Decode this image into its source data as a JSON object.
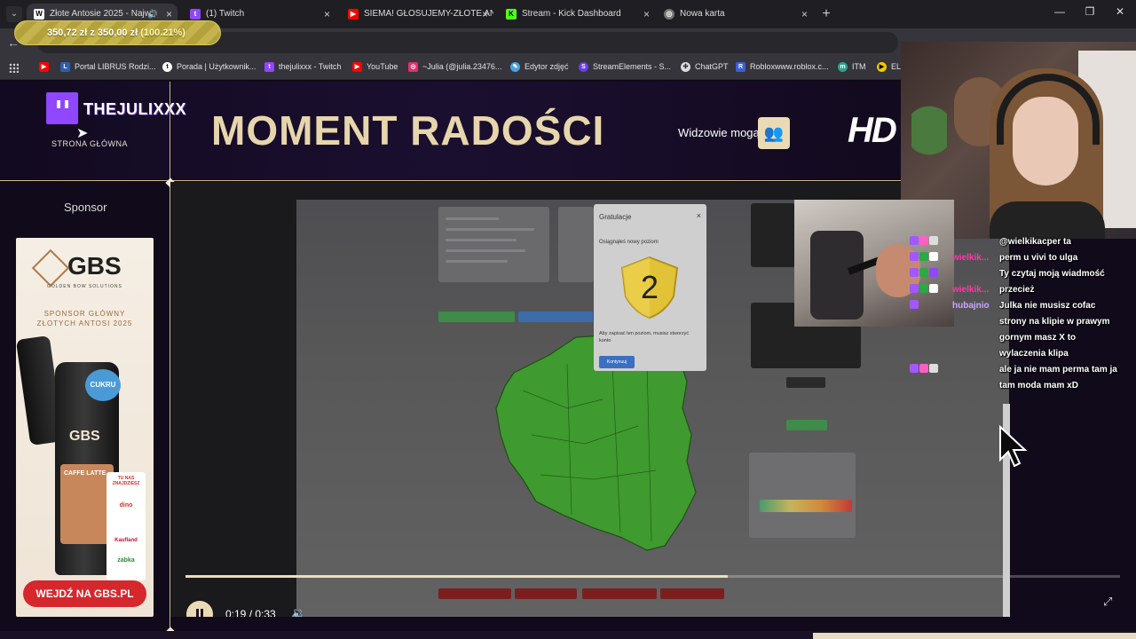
{
  "browser": {
    "tabs": [
      {
        "title": "Złote Antosie 2025 - Najwi",
        "active": true,
        "favicon": "wiki-icon"
      },
      {
        "title": "(1) Twitch",
        "active": false,
        "favicon": "twitch-icon"
      },
      {
        "title": "SIEMA! GŁOSUJEMY-ZŁOTE AN",
        "active": false,
        "favicon": "youtube-icon"
      },
      {
        "title": "Stream - Kick Dashboard",
        "active": false,
        "favicon": "kick-icon"
      },
      {
        "title": "Nowa karta",
        "active": false,
        "favicon": "chrome-icon"
      }
    ],
    "bookmarks": [
      {
        "label": "",
        "icon": "youtube-icon"
      },
      {
        "label": "Portal LIBRUS Rodzi...",
        "icon": "librus-icon"
      },
      {
        "label": "Porada | Użytkownik...",
        "icon": "tip-icon"
      },
      {
        "label": "thejulixxx - Twitch",
        "icon": "twitch-icon"
      },
      {
        "label": "YouTube",
        "icon": "youtube-icon"
      },
      {
        "label": "~Julia (@julia.23476...",
        "icon": "instagram-icon"
      },
      {
        "label": "Edytor zdjęć",
        "icon": "photo-editor-icon"
      },
      {
        "label": "StreamElements - S...",
        "icon": "streamelements-icon"
      },
      {
        "label": "ChatGPT",
        "icon": "chatgpt-icon"
      },
      {
        "label": "Robloxwww.roblox.c...",
        "icon": "roblox-icon"
      },
      {
        "label": "ITM",
        "icon": "itm-icon"
      },
      {
        "label": "EL",
        "icon": "el-icon"
      }
    ]
  },
  "donation_goal": {
    "text": "350,72 zł z 350,00 zł",
    "percent": "(100.21%)",
    "progress": 1.0021
  },
  "site": {
    "logo_name": "THEJULIXXX",
    "home_link": "STRONA GŁÓWNA",
    "page_title": "MOMENT RADOŚCI",
    "viewers_label": "Widzowie mogą",
    "hd_badge": "HD",
    "sponsor_label": "Sponsor"
  },
  "sponsor_ad": {
    "brand": "GBS",
    "brand_sub": "GOLDEN BOW SOLUTIONS",
    "headline_1": "SPONSOR GŁÓWNY",
    "headline_2": "ZŁOTYCH ANTOSI 2025",
    "can_brand": "GBS",
    "can_badge": "CUKRU",
    "flavor": "CAFFE LATTE",
    "stores_title": "TU NAS ZNAJDZIESZ",
    "stores": [
      "dino",
      "Kaufland",
      "żabka"
    ],
    "cta": "WEJDŹ NA GBS.PL"
  },
  "video": {
    "popup_title": "Gratulacje",
    "popup_close": "×",
    "popup_subtitle": "Osiągnąłeś nowy poziom",
    "popup_level": "2",
    "popup_desc": "Aby zapisać ten poziom, musisz stworzyć konto",
    "popup_button": "Kontynuuj",
    "progress": 0.58,
    "time": "0:19 / 0:33"
  },
  "chat": [
    {
      "user": "",
      "message": "@wielkikacper ta",
      "badges": [
        "#a257ff",
        "#ff5fc4",
        "#dddddd"
      ]
    },
    {
      "user": "wielkik...",
      "message": "perm u vivi to ulga",
      "badges": [
        "#a257ff",
        "#2aa944",
        "#ffffff"
      ]
    },
    {
      "user": "",
      "message": "Ty czytaj moją wiadmość",
      "badges": [
        "#a257ff",
        "#2aa944",
        "#9146ff"
      ]
    },
    {
      "user": "wielkik...",
      "message": "przecież",
      "badges": [
        "#a257ff",
        "#2aa944",
        "#ffffff"
      ]
    },
    {
      "user": "hubajnio",
      "message": "Julka nie musisz cofac",
      "badges": [
        "#a257ff"
      ]
    },
    {
      "user": "",
      "message": "strony na klipie w prawym",
      "badges": []
    },
    {
      "user": "",
      "message": "gornym masz X to",
      "badges": []
    },
    {
      "user": "",
      "message": "wylaczenia klipa",
      "badges": []
    },
    {
      "user": "",
      "message": "ale ja nie mam perma tam ja",
      "badges": [
        "#a257ff",
        "#ff5fc4",
        "#dddddd"
      ]
    },
    {
      "user": "",
      "message": "tam moda mam xD",
      "badges": []
    }
  ]
}
